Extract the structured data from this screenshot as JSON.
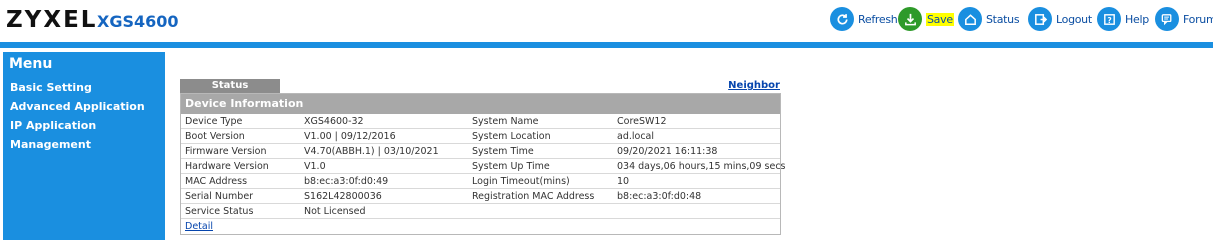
{
  "brand": {
    "logo": "ZYXEL",
    "model": "XGS4600"
  },
  "toolbar": {
    "refresh": "Refresh",
    "save": "Save",
    "status": "Status",
    "logout": "Logout",
    "help": "Help",
    "forum": "Forum"
  },
  "colors": {
    "accent": "#1a8fe0",
    "save_icon": "#2e9a2a",
    "highlight": "#ffff00",
    "link": "#0645ad"
  },
  "sidebar": {
    "title": "Menu",
    "items": [
      {
        "label": "Basic Setting"
      },
      {
        "label": "Advanced Application"
      },
      {
        "label": "IP Application"
      },
      {
        "label": "Management"
      }
    ]
  },
  "main": {
    "tab_label": "Status",
    "neighbor_link": "Neighbor",
    "section_title": "Device Information",
    "rows": [
      {
        "k1": "Device Type",
        "v1": "XGS4600-32",
        "k2": "System Name",
        "v2": "CoreSW12"
      },
      {
        "k1": "Boot Version",
        "v1": "V1.00 | 09/12/2016",
        "k2": "System Location",
        "v2": "ad.local"
      },
      {
        "k1": "Firmware Version",
        "v1": "V4.70(ABBH.1) | 03/10/2021",
        "k2": "System Time",
        "v2": "09/20/2021 16:11:38"
      },
      {
        "k1": "Hardware Version",
        "v1": "V1.0",
        "k2": "System Up Time",
        "v2": "034 days,06 hours,15 mins,09 secs"
      },
      {
        "k1": "MAC Address",
        "v1": "b8:ec:a3:0f:d0:49",
        "k2": "Login Timeout(mins)",
        "v2": "10"
      },
      {
        "k1": "Serial Number",
        "v1": "S162L42800036",
        "k2": "Registration MAC Address",
        "v2": "b8:ec:a3:0f:d0:48"
      },
      {
        "k1": "Service Status",
        "v1": "Not Licensed",
        "k2": "",
        "v2": ""
      }
    ],
    "detail_link": "Detail"
  }
}
